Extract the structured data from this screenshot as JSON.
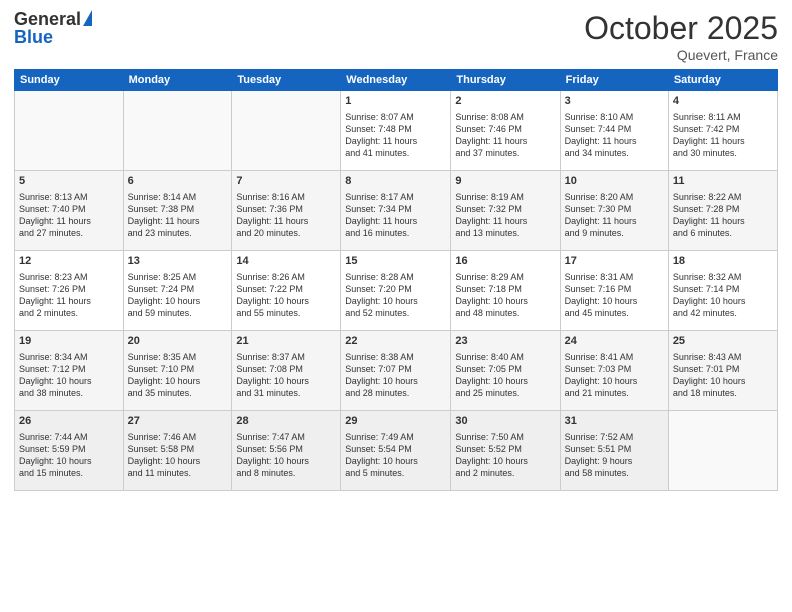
{
  "header": {
    "logo_general": "General",
    "logo_blue": "Blue",
    "month": "October 2025",
    "location": "Quevert, France"
  },
  "weekdays": [
    "Sunday",
    "Monday",
    "Tuesday",
    "Wednesday",
    "Thursday",
    "Friday",
    "Saturday"
  ],
  "weeks": [
    [
      {
        "day": "",
        "content": ""
      },
      {
        "day": "",
        "content": ""
      },
      {
        "day": "",
        "content": ""
      },
      {
        "day": "1",
        "content": "Sunrise: 8:07 AM\nSunset: 7:48 PM\nDaylight: 11 hours\nand 41 minutes."
      },
      {
        "day": "2",
        "content": "Sunrise: 8:08 AM\nSunset: 7:46 PM\nDaylight: 11 hours\nand 37 minutes."
      },
      {
        "day": "3",
        "content": "Sunrise: 8:10 AM\nSunset: 7:44 PM\nDaylight: 11 hours\nand 34 minutes."
      },
      {
        "day": "4",
        "content": "Sunrise: 8:11 AM\nSunset: 7:42 PM\nDaylight: 11 hours\nand 30 minutes."
      }
    ],
    [
      {
        "day": "5",
        "content": "Sunrise: 8:13 AM\nSunset: 7:40 PM\nDaylight: 11 hours\nand 27 minutes."
      },
      {
        "day": "6",
        "content": "Sunrise: 8:14 AM\nSunset: 7:38 PM\nDaylight: 11 hours\nand 23 minutes."
      },
      {
        "day": "7",
        "content": "Sunrise: 8:16 AM\nSunset: 7:36 PM\nDaylight: 11 hours\nand 20 minutes."
      },
      {
        "day": "8",
        "content": "Sunrise: 8:17 AM\nSunset: 7:34 PM\nDaylight: 11 hours\nand 16 minutes."
      },
      {
        "day": "9",
        "content": "Sunrise: 8:19 AM\nSunset: 7:32 PM\nDaylight: 11 hours\nand 13 minutes."
      },
      {
        "day": "10",
        "content": "Sunrise: 8:20 AM\nSunset: 7:30 PM\nDaylight: 11 hours\nand 9 minutes."
      },
      {
        "day": "11",
        "content": "Sunrise: 8:22 AM\nSunset: 7:28 PM\nDaylight: 11 hours\nand 6 minutes."
      }
    ],
    [
      {
        "day": "12",
        "content": "Sunrise: 8:23 AM\nSunset: 7:26 PM\nDaylight: 11 hours\nand 2 minutes."
      },
      {
        "day": "13",
        "content": "Sunrise: 8:25 AM\nSunset: 7:24 PM\nDaylight: 10 hours\nand 59 minutes."
      },
      {
        "day": "14",
        "content": "Sunrise: 8:26 AM\nSunset: 7:22 PM\nDaylight: 10 hours\nand 55 minutes."
      },
      {
        "day": "15",
        "content": "Sunrise: 8:28 AM\nSunset: 7:20 PM\nDaylight: 10 hours\nand 52 minutes."
      },
      {
        "day": "16",
        "content": "Sunrise: 8:29 AM\nSunset: 7:18 PM\nDaylight: 10 hours\nand 48 minutes."
      },
      {
        "day": "17",
        "content": "Sunrise: 8:31 AM\nSunset: 7:16 PM\nDaylight: 10 hours\nand 45 minutes."
      },
      {
        "day": "18",
        "content": "Sunrise: 8:32 AM\nSunset: 7:14 PM\nDaylight: 10 hours\nand 42 minutes."
      }
    ],
    [
      {
        "day": "19",
        "content": "Sunrise: 8:34 AM\nSunset: 7:12 PM\nDaylight: 10 hours\nand 38 minutes."
      },
      {
        "day": "20",
        "content": "Sunrise: 8:35 AM\nSunset: 7:10 PM\nDaylight: 10 hours\nand 35 minutes."
      },
      {
        "day": "21",
        "content": "Sunrise: 8:37 AM\nSunset: 7:08 PM\nDaylight: 10 hours\nand 31 minutes."
      },
      {
        "day": "22",
        "content": "Sunrise: 8:38 AM\nSunset: 7:07 PM\nDaylight: 10 hours\nand 28 minutes."
      },
      {
        "day": "23",
        "content": "Sunrise: 8:40 AM\nSunset: 7:05 PM\nDaylight: 10 hours\nand 25 minutes."
      },
      {
        "day": "24",
        "content": "Sunrise: 8:41 AM\nSunset: 7:03 PM\nDaylight: 10 hours\nand 21 minutes."
      },
      {
        "day": "25",
        "content": "Sunrise: 8:43 AM\nSunset: 7:01 PM\nDaylight: 10 hours\nand 18 minutes."
      }
    ],
    [
      {
        "day": "26",
        "content": "Sunrise: 7:44 AM\nSunset: 5:59 PM\nDaylight: 10 hours\nand 15 minutes."
      },
      {
        "day": "27",
        "content": "Sunrise: 7:46 AM\nSunset: 5:58 PM\nDaylight: 10 hours\nand 11 minutes."
      },
      {
        "day": "28",
        "content": "Sunrise: 7:47 AM\nSunset: 5:56 PM\nDaylight: 10 hours\nand 8 minutes."
      },
      {
        "day": "29",
        "content": "Sunrise: 7:49 AM\nSunset: 5:54 PM\nDaylight: 10 hours\nand 5 minutes."
      },
      {
        "day": "30",
        "content": "Sunrise: 7:50 AM\nSunset: 5:52 PM\nDaylight: 10 hours\nand 2 minutes."
      },
      {
        "day": "31",
        "content": "Sunrise: 7:52 AM\nSunset: 5:51 PM\nDaylight: 9 hours\nand 58 minutes."
      },
      {
        "day": "",
        "content": ""
      }
    ]
  ]
}
